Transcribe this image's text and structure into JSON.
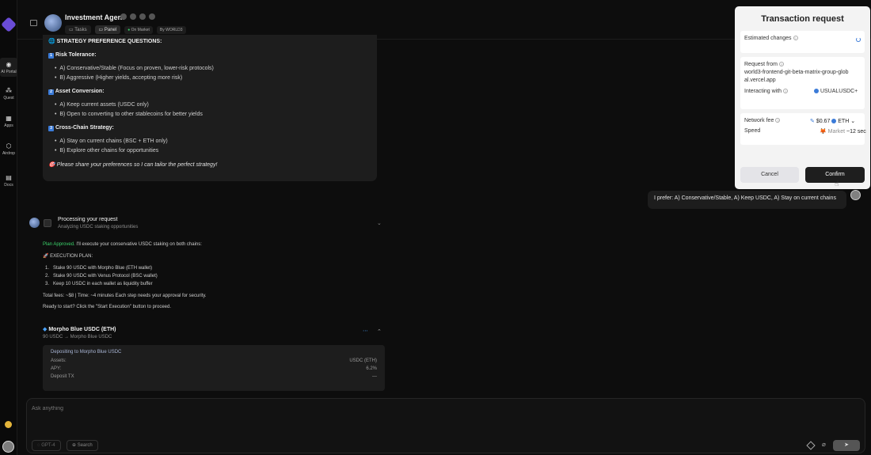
{
  "rail": {
    "items": [
      {
        "label": "AI Portal"
      },
      {
        "label": "Quest"
      },
      {
        "label": "Apps"
      },
      {
        "label": "Airdrop"
      },
      {
        "label": "Docs"
      }
    ]
  },
  "header": {
    "title": "Investment Agent",
    "tabs": [
      "Tasks",
      "Panel"
    ],
    "status": "On Market",
    "by": "By WORLD3"
  },
  "prev_message": {
    "heading": "STRATEGY PREFERENCE QUESTIONS:",
    "sections": [
      {
        "title": "Risk Tolerance:",
        "num": "1",
        "options": [
          "A) Conservative/Stable (Focus on proven, lower-risk protocols)",
          "B) Aggressive (Higher yields, accepting more risk)"
        ]
      },
      {
        "title": "Asset Conversion:",
        "num": "2",
        "options": [
          "A) Keep current assets (USDC only)",
          "B) Open to converting to other stablecoins for better yields"
        ]
      },
      {
        "title": "Cross-Chain Strategy:",
        "num": "3",
        "options": [
          "A) Stay on current chains (BSC + ETH only)",
          "B) Explore other chains for opportunities"
        ]
      }
    ],
    "footer": "Please share your preferences so I can tailor the perfect strategy!"
  },
  "user_message": "I prefer: A) Conservative/Stable, A) Keep USDC, A) Stay on current chains",
  "processing": {
    "title": "Processing your request",
    "subtitle": "Analyzing USDC staking opportunities",
    "approved_label": "Plan Approved.",
    "approved_text": "I'll execute your conservative USDC staking on both chains:",
    "plan_label": "EXECUTION PLAN:",
    "steps": [
      "Stake 90 USDC with Morpho Blue (ETH wallet)",
      "Stake 90 USDC with Venus Protocol (BSC wallet)",
      "Keep 10 USDC in each wallet as liquidity buffer"
    ],
    "totals": "Total fees: ~$8 | Time: ~4 minutes Each step needs your approval for security.",
    "ready": "Ready to start? Click the \"Start Execution\" button to proceed."
  },
  "morpho": {
    "title": "Morpho Blue USDC (ETH)",
    "subtitle": "90 USDC → Morpho Blue USDC",
    "depositing": "Depositing to Morpho Blue USDC",
    "rows": [
      {
        "label": "Assets:",
        "value": "USDC (ETH)"
      },
      {
        "label": "APY:",
        "value": "6.2%"
      },
      {
        "label": "Deposit TX",
        "value": "—"
      }
    ]
  },
  "modal": {
    "title": "Transaction request",
    "estimated_changes": "Estimated changes",
    "request_from_label": "Request from",
    "request_from_value": "world3-frontend-git-beta-matrix-group-global.vercel.app",
    "interacting_label": "Interacting with",
    "interacting_value": "USUALUSDC+",
    "network_fee_label": "Network fee",
    "network_fee_value": "$0.67",
    "network_fee_token": "ETH",
    "speed_label": "Speed",
    "speed_value": "Market",
    "speed_time": "~12 sec",
    "cancel": "Cancel",
    "confirm": "Confirm"
  },
  "composer": {
    "placeholder": "Ask anything",
    "model": "GPT-4",
    "search": "Search"
  },
  "colors": {
    "approved": "#3bd36b",
    "confirm_bg": "#1e1e1e",
    "cancel_bg": "#e4e4e8"
  }
}
